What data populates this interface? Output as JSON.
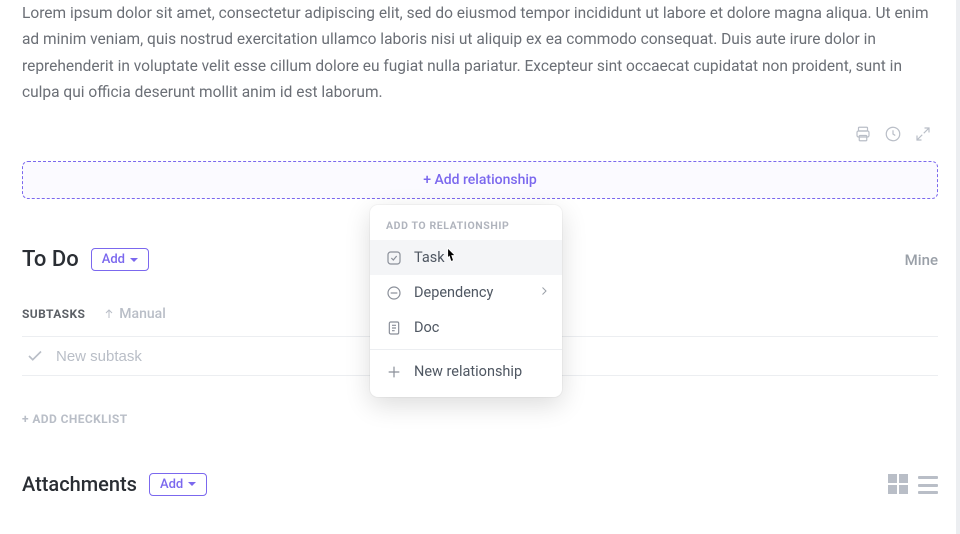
{
  "description": "Lorem ipsum dolor sit amet, consectetur adipiscing elit, sed do eiusmod tempor incididunt ut labore et dolore magna aliqua. Ut enim ad minim veniam, quis nostrud exercitation ullamco laboris nisi ut aliquip ex ea commodo consequat. Duis aute irure dolor in reprehenderit in voluptate velit esse cillum dolore eu fugiat nulla pariatur. Excepteur sint occaecat cupidatat non proident, sunt in culpa qui officia deserunt mollit anim id est laborum.",
  "add_relationship_label": "+ Add relationship",
  "todo": {
    "title": "To Do",
    "add_label": "Add",
    "mine_label": "Mine"
  },
  "subtasks": {
    "label": "SUBTASKS",
    "sort_label": "Manual",
    "new_placeholder": "New subtask"
  },
  "add_checklist_label": "+ ADD CHECKLIST",
  "attachments": {
    "title": "Attachments",
    "add_label": "Add"
  },
  "dropdown": {
    "header": "ADD TO RELATIONSHIP",
    "items": [
      {
        "label": "Task",
        "icon": "task-check-icon",
        "has_sub": false
      },
      {
        "label": "Dependency",
        "icon": "dependency-icon",
        "has_sub": true
      },
      {
        "label": "Doc",
        "icon": "doc-icon",
        "has_sub": false
      }
    ],
    "new_label": "New relationship"
  }
}
